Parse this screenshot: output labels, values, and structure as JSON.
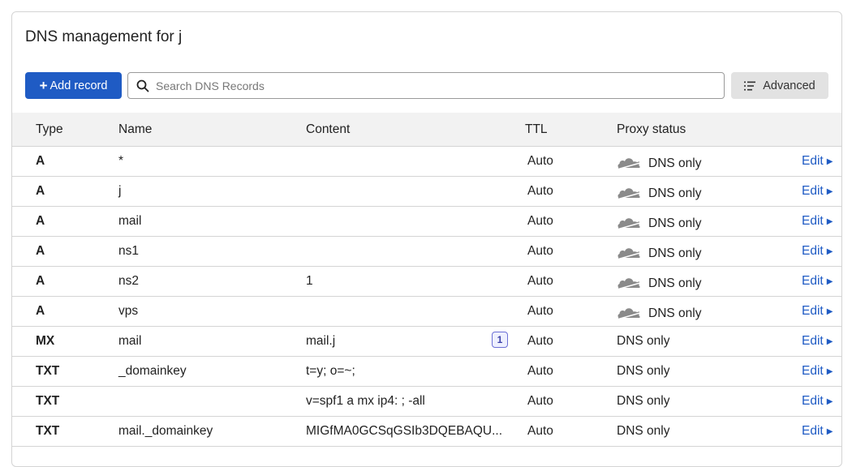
{
  "page": {
    "title": "DNS management for j"
  },
  "toolbar": {
    "add_label": "Add record",
    "search_placeholder": "Search DNS Records",
    "advanced_label": "Advanced"
  },
  "table": {
    "headers": {
      "type": "Type",
      "name": "Name",
      "content": "Content",
      "ttl": "TTL",
      "proxy": "Proxy status"
    },
    "edit_label": "Edit",
    "rows": [
      {
        "type": "A",
        "name": "*",
        "content": "",
        "ttl": "Auto",
        "proxy": "DNS only",
        "cloud": true
      },
      {
        "type": "A",
        "name": "j",
        "content": "",
        "ttl": "Auto",
        "proxy": "DNS only",
        "cloud": true
      },
      {
        "type": "A",
        "name": "mail",
        "content": "",
        "ttl": "Auto",
        "proxy": "DNS only",
        "cloud": true
      },
      {
        "type": "A",
        "name": "ns1",
        "content": "",
        "ttl": "Auto",
        "proxy": "DNS only",
        "cloud": true
      },
      {
        "type": "A",
        "name": "ns2",
        "content": "1",
        "ttl": "Auto",
        "proxy": "DNS only",
        "cloud": true
      },
      {
        "type": "A",
        "name": "vps",
        "content": "",
        "ttl": "Auto",
        "proxy": "DNS only",
        "cloud": true
      },
      {
        "type": "MX",
        "name": "mail",
        "content": "mail.j",
        "ttl": "Auto",
        "proxy": "DNS only",
        "cloud": false,
        "badge": "1"
      },
      {
        "type": "TXT",
        "name": "_domainkey",
        "content": "t=y; o=~;",
        "ttl": "Auto",
        "proxy": "DNS only",
        "cloud": false
      },
      {
        "type": "TXT",
        "name": "",
        "content": "v=spf1 a mx ip4:               ; -all",
        "ttl": "Auto",
        "proxy": "DNS only",
        "cloud": false
      },
      {
        "type": "TXT",
        "name": "mail._domainkey",
        "content": "MIGfMA0GCSqGSIb3DQEBAQU...",
        "ttl": "Auto",
        "proxy": "DNS only",
        "cloud": false
      }
    ]
  },
  "colors": {
    "primary": "#1f5bc4",
    "cloud_gray": "#8a8a8a",
    "header_bg": "#f2f2f2"
  }
}
